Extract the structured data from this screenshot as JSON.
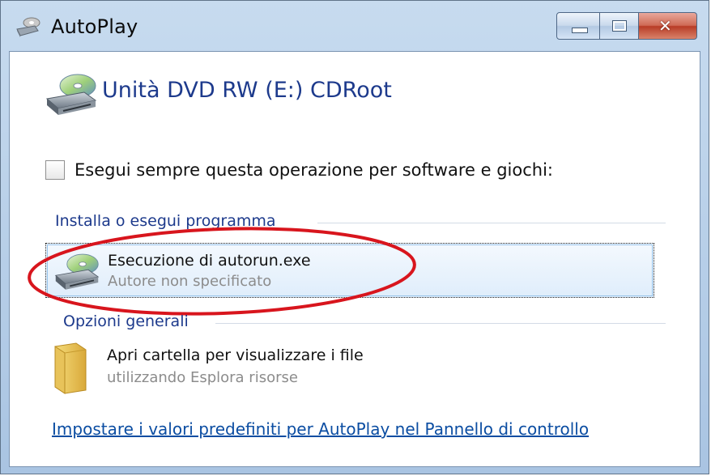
{
  "window": {
    "title": "AutoPlay",
    "controls": {
      "minimize": "minimize",
      "maximize": "maximize",
      "close": "close"
    }
  },
  "drive": {
    "title": "Unità DVD RW (E:) CDRoot",
    "icon": "dvd-drive-icon"
  },
  "always_option": {
    "label": "Esegui sempre questa operazione per software e giochi:",
    "checked": false
  },
  "groups": [
    {
      "heading": "Installa o esegui programma",
      "items": [
        {
          "title": "Esecuzione di autorun.exe",
          "subtitle": "Autore non specificato",
          "icon": "dvd-drive-icon",
          "selected": true
        }
      ]
    },
    {
      "heading": "Opzioni generali",
      "items": [
        {
          "title": "Apri cartella per visualizzare i file",
          "subtitle": "utilizzando Esplora risorse",
          "icon": "folder-icon",
          "selected": false
        }
      ]
    }
  ],
  "control_panel_link": "Impostare i valori predefiniti per AutoPlay nel Pannello di controllo",
  "colors": {
    "accent": "#1d3a8c",
    "link": "#0b4da2",
    "annotation": "#d8151d",
    "frame": "#a9c4e2"
  }
}
